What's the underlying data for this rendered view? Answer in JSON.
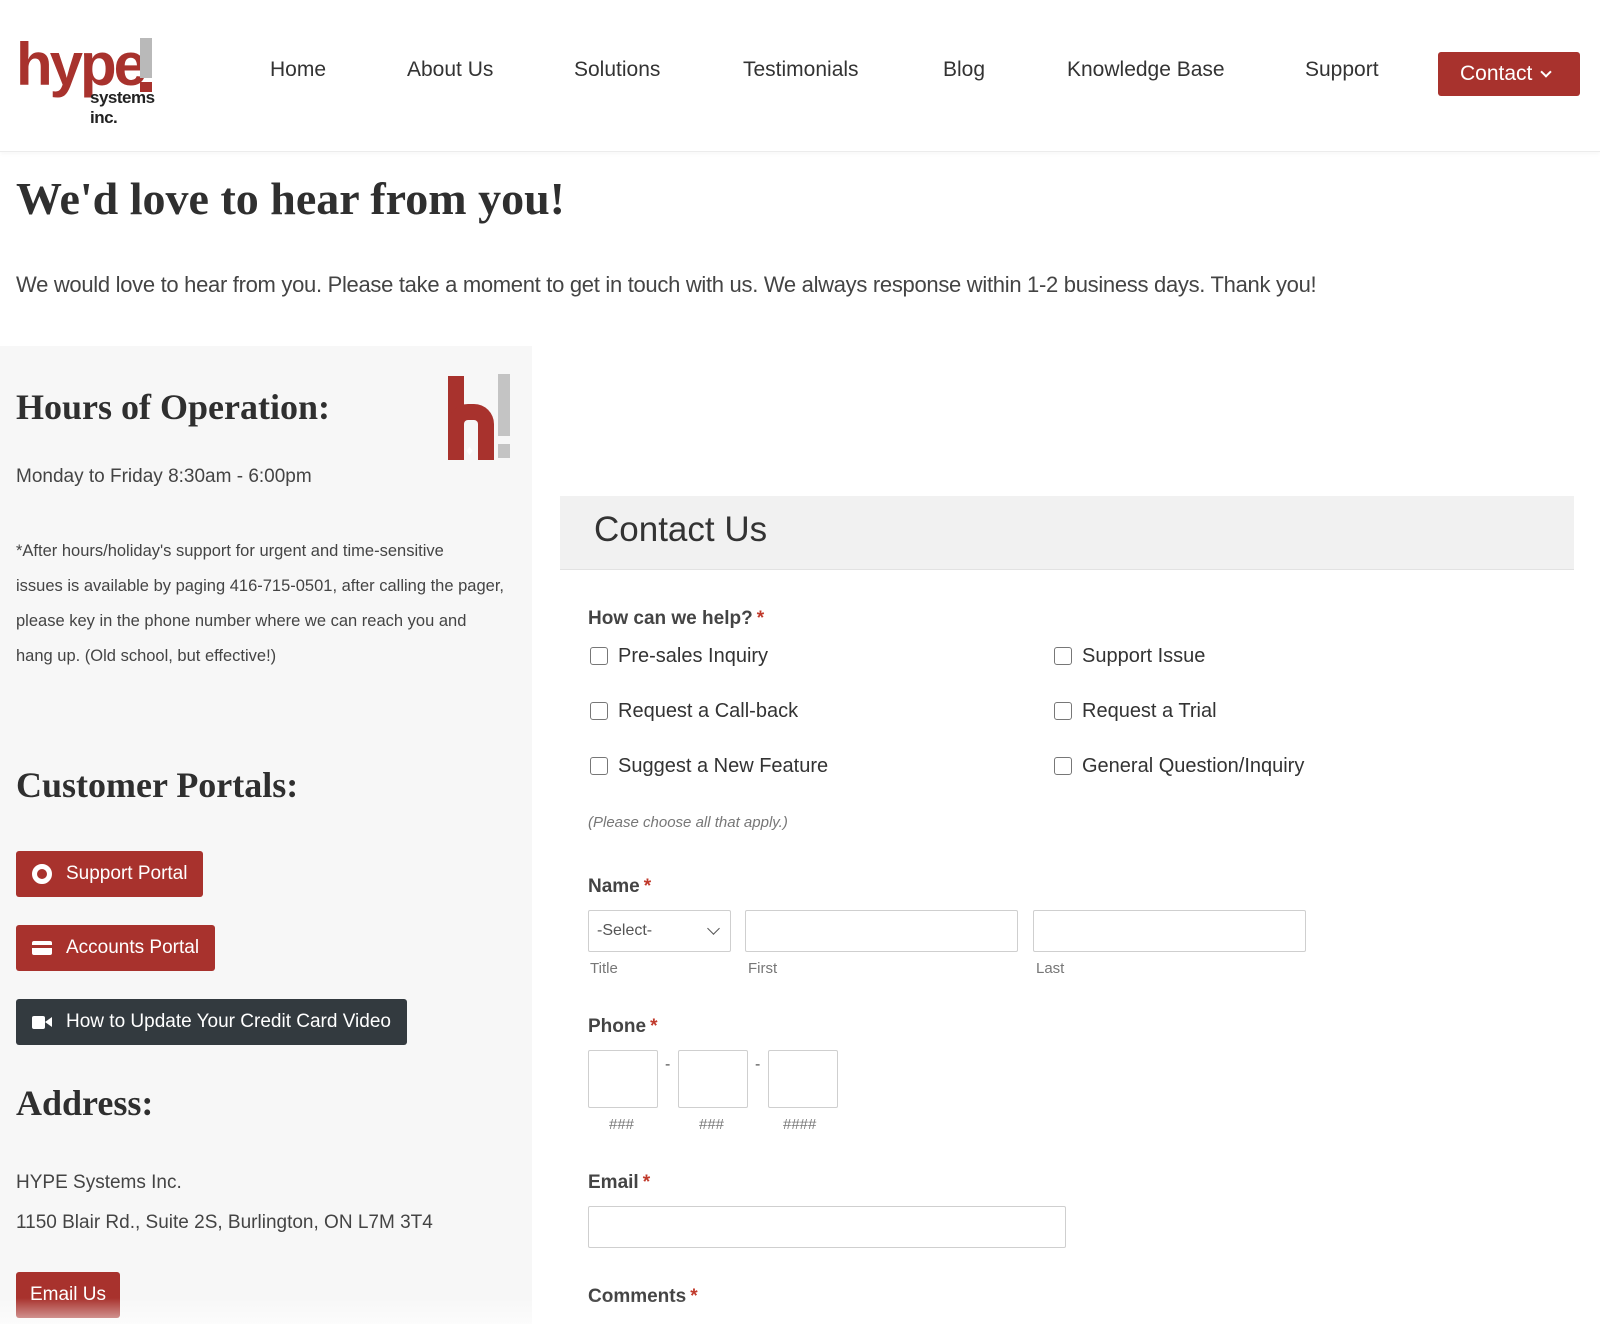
{
  "logo": {
    "main": "hype",
    "sub": "systems inc."
  },
  "nav": {
    "items": [
      "Home",
      "About Us",
      "Solutions",
      "Testimonials",
      "Blog",
      "Knowledge Base",
      "Support"
    ],
    "contact_label": "Contact"
  },
  "intro": {
    "title": "We'd love to hear from you!",
    "text": "We would love to hear from you. Please take a moment to get in touch with us. We always response within 1-2 business days. Thank you!"
  },
  "hours": {
    "heading": "Hours of Operation:",
    "schedule": "Monday to Friday 8:30am - 6:00pm",
    "note_lines": [
      "*After hours/holiday's  support  for urgent and time-sensitive",
      "issues is available by paging 416-715-0501, after calling the pager,",
      "please key in the phone number where we can reach you and",
      "hang up. (Old school, but effective!)"
    ]
  },
  "portals": {
    "heading": "Customer Portals:",
    "support_portal": "Support Portal",
    "accounts_portal": "Accounts Portal",
    "credit_card_video": "How to Update Your Credit Card Video"
  },
  "address": {
    "heading": "Address:",
    "company": "HYPE Systems Inc.",
    "street": "1150 Blair Rd., Suite 2S, Burlington, ON  L7M 3T4",
    "email_button": "Email Us"
  },
  "form": {
    "title": "Contact Us",
    "help_label": "How can we help?",
    "required_mark": "*",
    "options": [
      "Pre-sales Inquiry",
      "Support Issue",
      "Request a Call-back",
      "Request a Trial",
      "Suggest a New Feature",
      "General Question/Inquiry"
    ],
    "help_note": "(Please choose all that apply.)",
    "name_label": "Name",
    "title_select_value": "-Select-",
    "name_sublabels": [
      "Title",
      "First",
      "Last"
    ],
    "phone_label": "Phone",
    "phone_sublabels": [
      "###",
      "###",
      "####"
    ],
    "phone_separator": "-",
    "email_label": "Email",
    "comments_label": "Comments"
  },
  "colors": {
    "brand_red": "#a8322d",
    "dark_button": "#333a3f",
    "panel_bg": "#f7f7f7"
  },
  "icons": [
    "lifebuoy-icon",
    "credit-card-icon",
    "video-camera-icon",
    "chevron-down-icon"
  ]
}
